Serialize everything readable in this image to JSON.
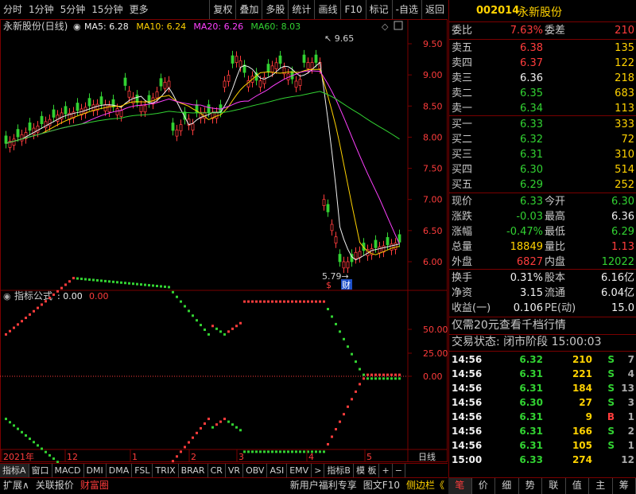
{
  "toolbar": {
    "left": [
      "分时",
      "1分钟",
      "5分钟",
      "15分钟",
      "更多"
    ],
    "right": [
      "复权",
      "叠加",
      "多股",
      "统计",
      "画线",
      "F10",
      "标记",
      "-自选",
      "返回"
    ]
  },
  "chart": {
    "title": "永新股份(日线)",
    "ma_legend": [
      {
        "label": "MA5: 6.28",
        "color": "#f0f0f0"
      },
      {
        "label": "MA10: 6.24",
        "color": "#ffd200"
      },
      {
        "label": "MA20: 6.26",
        "color": "#ff40ff"
      },
      {
        "label": "MA60: 8.03",
        "color": "#32d232"
      }
    ],
    "price_axis": [
      "9.50",
      "9.00",
      "8.50",
      "8.00",
      "7.50",
      "7.00",
      "6.50",
      "6.00"
    ],
    "high_label": "9.65",
    "low_label": "5.79",
    "marker_s": "$",
    "marker_cai": "财",
    "indicator_title": "指标公式",
    "indicator_v1": ": 0.00",
    "indicator_v2": "0.00",
    "ind_axis": [
      "50.00",
      "25.00",
      "0.00"
    ],
    "time_axis": [
      "2021年",
      "12",
      "1",
      "2",
      "3",
      "4",
      "5"
    ],
    "time_axis_right": "日线",
    "colors": {
      "up": "#ff3c3c",
      "down": "#32d232",
      "ma5": "#f0f0f0",
      "ma10": "#ffd200",
      "ma20": "#ff40ff",
      "ma60": "#32d232",
      "frame": "#7a0000"
    }
  },
  "tabs": [
    "指标A",
    "窗口",
    "MACD",
    "DMI",
    "DMA",
    "FSL",
    "TRIX",
    "BRAR",
    "CR",
    "VR",
    "OBV",
    "ASI",
    "EMV",
    ">",
    "指标B",
    "模 板",
    "+",
    "−"
  ],
  "status_left": [
    "扩展∧",
    "关联报价",
    "财富圈"
  ],
  "status_right": [
    "新用户福利专享",
    "图文F10",
    "侧边栏《"
  ],
  "quote": {
    "code": "002014",
    "name": "永新股份",
    "weibi_label": "委比",
    "weibi": "7.63%",
    "weicha_label": "委差",
    "weicha": "210",
    "asks": [
      {
        "label": "卖五",
        "price": "6.38",
        "vol": "135"
      },
      {
        "label": "卖四",
        "price": "6.37",
        "vol": "122"
      },
      {
        "label": "卖三",
        "price": "6.36",
        "vol": "218"
      },
      {
        "label": "卖二",
        "price": "6.35",
        "vol": "683"
      },
      {
        "label": "卖一",
        "price": "6.34",
        "vol": "113"
      }
    ],
    "bids": [
      {
        "label": "买一",
        "price": "6.33",
        "vol": "333"
      },
      {
        "label": "买二",
        "price": "6.32",
        "vol": "72"
      },
      {
        "label": "买三",
        "price": "6.31",
        "vol": "310"
      },
      {
        "label": "买四",
        "price": "6.30",
        "vol": "514"
      },
      {
        "label": "买五",
        "price": "6.29",
        "vol": "252"
      }
    ],
    "stats": [
      {
        "l1": "现价",
        "v1": "6.33",
        "c1": "green",
        "l2": "今开",
        "v2": "6.30",
        "c2": "green"
      },
      {
        "l1": "涨跌",
        "v1": "-0.03",
        "c1": "green",
        "l2": "最高",
        "v2": "6.36",
        "c2": "white"
      },
      {
        "l1": "涨幅",
        "v1": "-0.47%",
        "c1": "green",
        "l2": "最低",
        "v2": "6.29",
        "c2": "green"
      },
      {
        "l1": "总量",
        "v1": "18849",
        "c1": "yellow",
        "l2": "量比",
        "v2": "1.13",
        "c2": "red"
      },
      {
        "l1": "外盘",
        "v1": "6827",
        "c1": "red",
        "l2": "内盘",
        "v2": "12022",
        "c2": "green"
      }
    ],
    "fund": [
      {
        "l1": "换手",
        "v1": "0.31%",
        "l2": "股本",
        "v2": "6.16亿"
      },
      {
        "l1": "净资",
        "v1": "3.15",
        "l2": "流通",
        "v2": "6.04亿"
      },
      {
        "l1": "收益(一)",
        "v1": "0.106",
        "l2": "PE(动)",
        "v2": "15.0"
      }
    ],
    "promo": "仅需20元查看千档行情",
    "trade_status": "交易状态: 闭市阶段 15:00:03",
    "ticks": [
      {
        "t": "14:56",
        "p": "6.32",
        "pc": "green",
        "v": "210",
        "bs": "S",
        "n": "7"
      },
      {
        "t": "14:56",
        "p": "6.31",
        "pc": "green",
        "v": "221",
        "bs": "S",
        "n": "4"
      },
      {
        "t": "14:56",
        "p": "6.31",
        "pc": "green",
        "v": "184",
        "bs": "S",
        "n": "13"
      },
      {
        "t": "14:56",
        "p": "6.30",
        "pc": "green",
        "v": "27",
        "bs": "S",
        "n": "3"
      },
      {
        "t": "14:56",
        "p": "6.31",
        "pc": "green",
        "v": "9",
        "bs": "B",
        "n": "1"
      },
      {
        "t": "14:56",
        "p": "6.31",
        "pc": "green",
        "v": "166",
        "bs": "S",
        "n": "2"
      },
      {
        "t": "14:56",
        "p": "6.31",
        "pc": "green",
        "v": "105",
        "bs": "S",
        "n": "1"
      },
      {
        "t": "15:00",
        "p": "6.33",
        "pc": "green",
        "v": "274",
        "bs": "",
        "n": "12"
      }
    ],
    "bottom_tabs": [
      "笔",
      "价",
      "细",
      "势",
      "联",
      "值",
      "主",
      "筹"
    ]
  }
}
